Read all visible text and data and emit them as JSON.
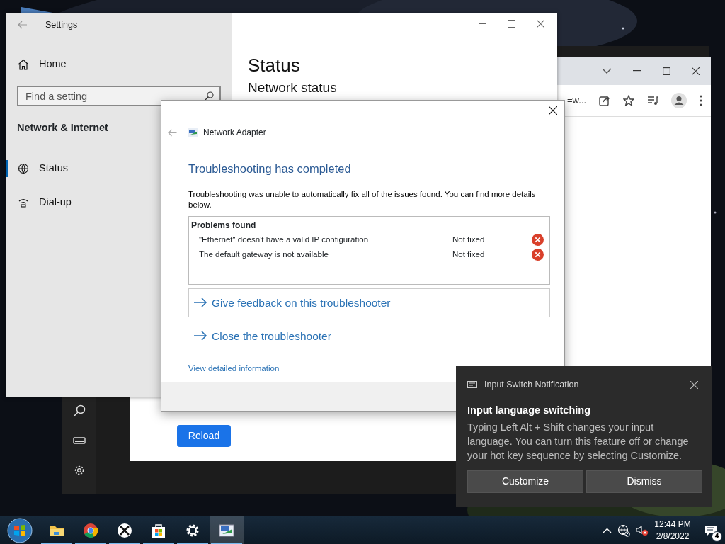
{
  "settings_window": {
    "title": "Settings",
    "home": "Home",
    "search": {
      "placeholder": "Find a setting"
    },
    "section": "Network & Internet",
    "nav": [
      {
        "label": "Status",
        "selected": true
      },
      {
        "label": "Dial-up",
        "selected": false
      }
    ],
    "heading": "Status",
    "subheading": "Network status"
  },
  "browser_window": {
    "address": "=w...",
    "button": "Reload"
  },
  "dialog": {
    "title": "Network Adapter",
    "heading": "Troubleshooting has completed",
    "message": "Troubleshooting was unable to automatically fix all of the issues found. You can find more details below.",
    "problems_title": "Problems found",
    "problems": [
      {
        "problem": "\"Ethernet\" doesn't have a valid IP configuration",
        "status": "Not fixed",
        "fixed": false
      },
      {
        "problem": "The default gateway is not available",
        "status": "Not fixed",
        "fixed": false
      }
    ],
    "links": [
      {
        "label": "Give feedback on this troubleshooter",
        "boxed": true
      },
      {
        "label": "Close the troubleshooter",
        "boxed": false
      }
    ],
    "details_link": "View detailed information"
  },
  "notification": {
    "app": "Input Switch Notification",
    "title": "Input language switching",
    "body": "Typing Left Alt + Shift changes your input language. You can turn this feature off or change your hot key sequence by selecting Customize.",
    "buttons": [
      "Customize",
      "Dismiss"
    ]
  },
  "taskbar": {
    "apps": [
      {
        "kind": "explorer",
        "running": true,
        "selected": false
      },
      {
        "kind": "chrome",
        "running": true,
        "selected": false
      },
      {
        "kind": "xbox",
        "running": true,
        "selected": false
      },
      {
        "kind": "store",
        "running": true,
        "selected": false
      },
      {
        "kind": "settings",
        "running": true,
        "selected": false
      },
      {
        "kind": "troubleshooter",
        "running": true,
        "selected": true
      }
    ],
    "time": "12:44 PM",
    "date": "2/8/2022",
    "notification_count": "4"
  }
}
